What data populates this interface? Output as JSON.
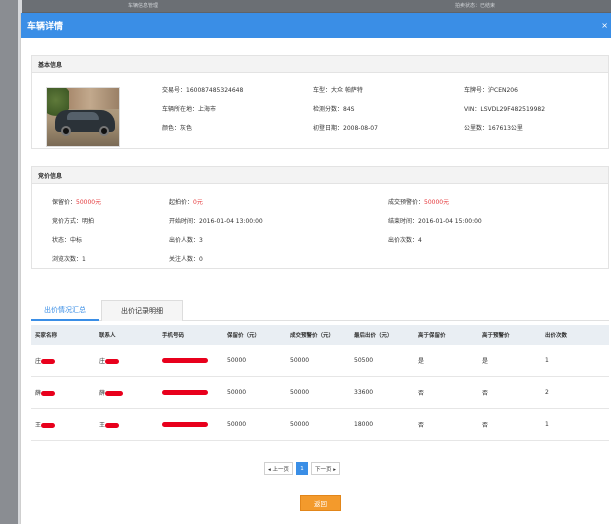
{
  "modal": {
    "title": "车辆详情",
    "close_glyph": "×"
  },
  "basic": {
    "heading": "基本信息",
    "fields": [
      {
        "label": "交易号：",
        "value": "160087485324648"
      },
      {
        "label": "车型：",
        "value": "大众 帕萨特"
      },
      {
        "label": "车牌号：",
        "value": "沪CEN206"
      },
      {
        "label": "车辆所在地：",
        "value": "上海市"
      },
      {
        "label": "检测分数：",
        "value": "84S"
      },
      {
        "label": "VIN：",
        "value": "LSVDL29F482519982"
      },
      {
        "label": "颜色：",
        "value": "灰色"
      },
      {
        "label": "初登日期：",
        "value": "2008-08-07"
      },
      {
        "label": "公里数：",
        "value": "167613公里"
      }
    ]
  },
  "auction": {
    "heading": "竞价信息",
    "reserve_label": "保留价：",
    "reserve_value": "50000元",
    "start_label": "起拍价：",
    "start_value": "0元",
    "deal_label": "成交预警价：",
    "deal_value": "50000元",
    "mode_label": "竞价方式：",
    "mode_value": "明拍",
    "begin_label": "开始时间：",
    "begin_value": "2016-01-04 13:00:00",
    "end_label": "结束时间：",
    "end_value": "2016-01-04 15:00:00",
    "status_label": "状态：",
    "status_value": "中标",
    "bidders_label": "出价人数：",
    "bidders_value": "3",
    "bids_label": "出价次数：",
    "bids_value": "4",
    "views_label": "浏览次数：",
    "views_value": "1",
    "follows_label": "关注人数：",
    "follows_value": "0"
  },
  "tabs": {
    "summary": "出价情况汇总",
    "records": "出价记录明细"
  },
  "table": {
    "headers": [
      "买家名称",
      "联系人",
      "手机号码",
      "保留价（元）",
      "成交预警价（元）",
      "最后出价（元）",
      "高于保留价",
      "高于预警价",
      "出价次数"
    ],
    "rows": [
      {
        "buyer": "庄",
        "contact": "庄",
        "reserve": "50000",
        "warn": "50000",
        "last": "50500",
        "above_reserve": "是",
        "above_warn": "是",
        "count": "1"
      },
      {
        "buyer": "薛",
        "contact": "薛",
        "reserve": "50000",
        "warn": "50000",
        "last": "33600",
        "above_reserve": "否",
        "above_warn": "否",
        "count": "2"
      },
      {
        "buyer": "王",
        "contact": "王",
        "reserve": "50000",
        "warn": "50000",
        "last": "18000",
        "above_reserve": "否",
        "above_warn": "否",
        "count": "1"
      }
    ]
  },
  "pager": {
    "prev": "◂ 上一页",
    "page": "1",
    "next": "下一页 ▸"
  },
  "back_button": "返回",
  "background_text": {
    "left": "车辆信息管理",
    "right": "拍卖状态：已结束"
  },
  "colors": {
    "header_blue": "#3a8ee6",
    "highlight_red": "#e4393c",
    "back_orange": "#f39a2c"
  }
}
